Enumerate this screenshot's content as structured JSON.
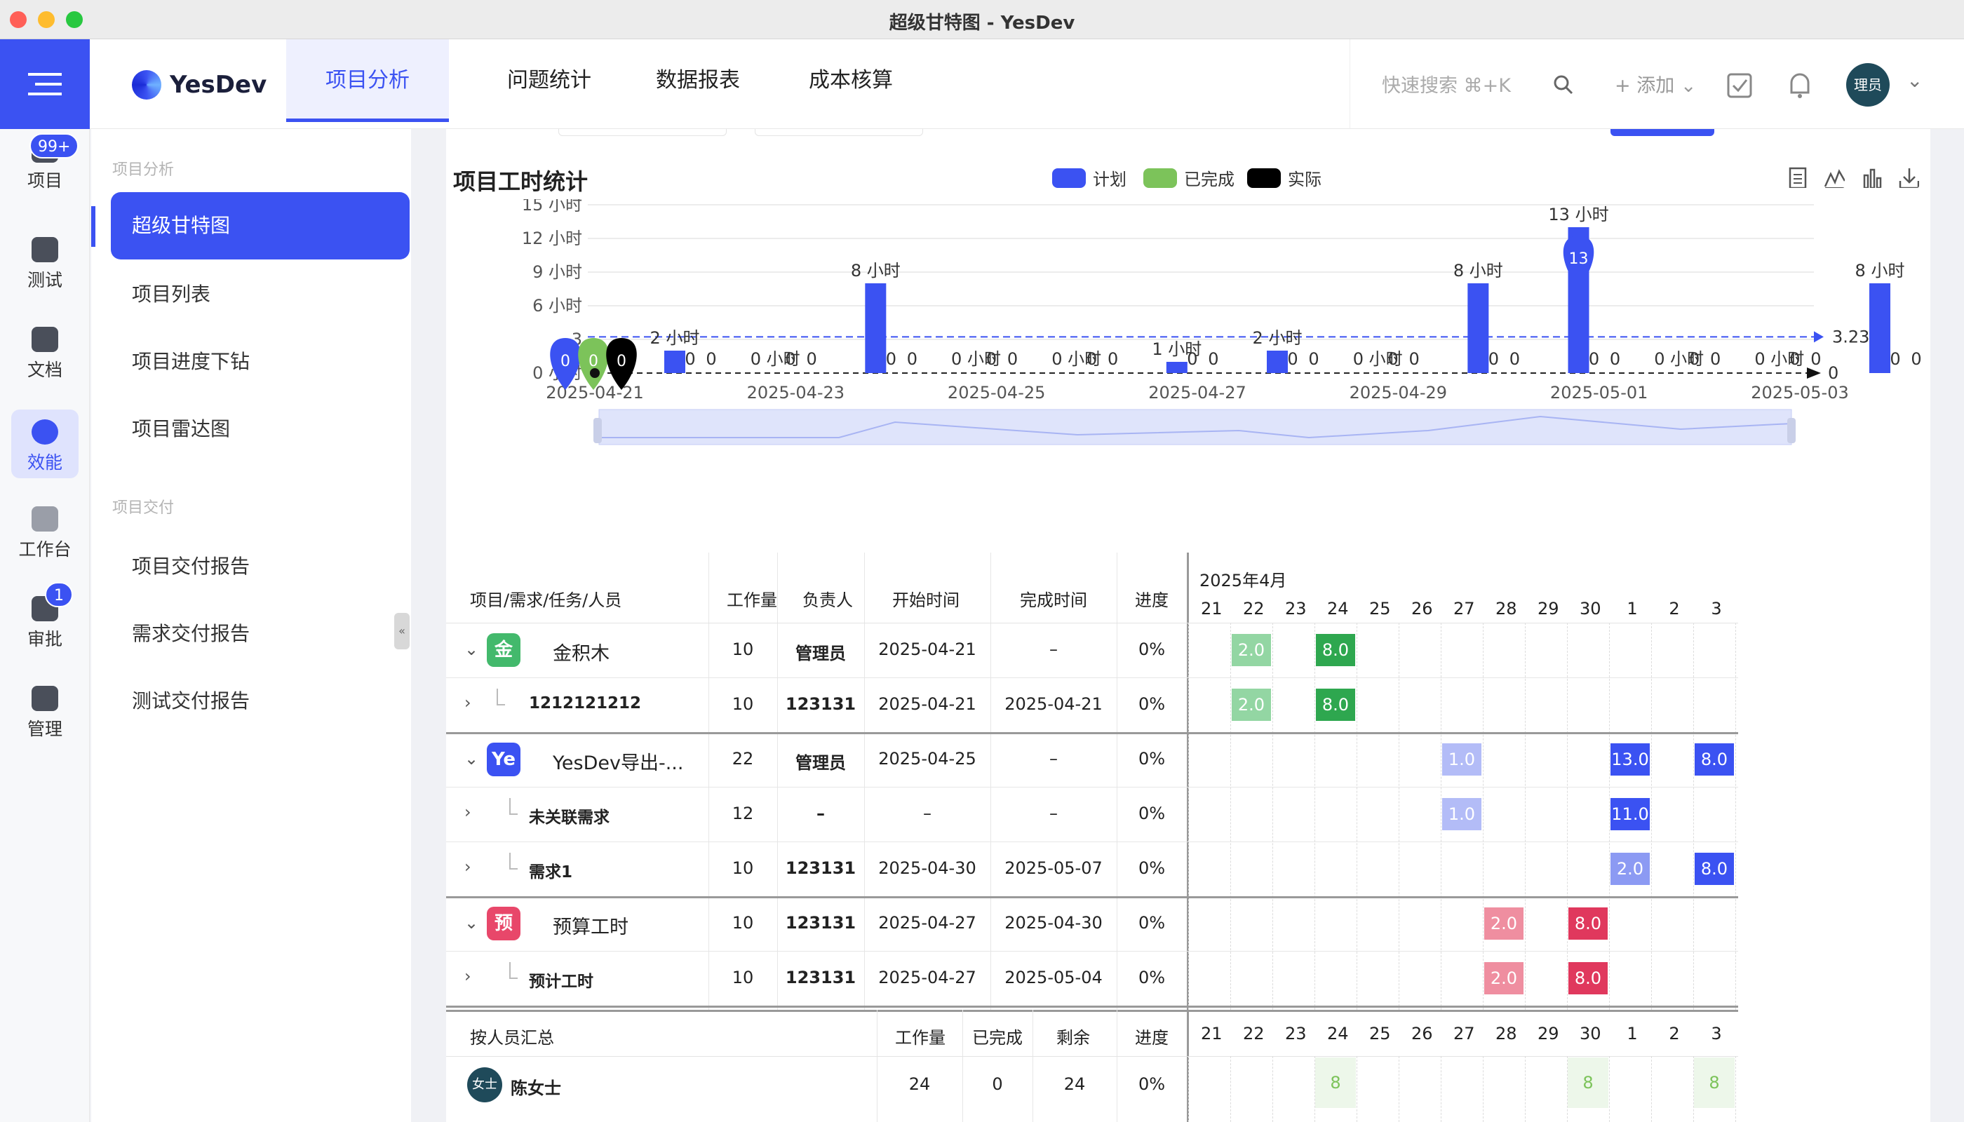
{
  "window": {
    "title": "超级甘特图 - YesDev"
  },
  "rail": {
    "items": [
      {
        "label": "项目",
        "badge": "99+"
      },
      {
        "label": "测试"
      },
      {
        "label": "文档"
      },
      {
        "label": "效能"
      },
      {
        "label": "工作台"
      },
      {
        "label": "审批",
        "badge": "1"
      },
      {
        "label": "管理"
      }
    ]
  },
  "header": {
    "logo": "YesDev",
    "tabs": [
      "项目分析",
      "问题统计",
      "数据报表",
      "成本核算"
    ],
    "search_placeholder": "快速搜索 ⌘+K",
    "add_label": "+ 添加",
    "user": "理员"
  },
  "sidebar": {
    "group1": "项目分析",
    "items1": [
      "超级甘特图",
      "项目列表",
      "项目进度下钻",
      "项目雷达图"
    ],
    "group2": "项目交付",
    "items2": [
      "项目交付报告",
      "需求交付报告",
      "测试交付报告"
    ]
  },
  "chart_section": {
    "title": "项目工时统计"
  },
  "chart_data": {
    "type": "bar",
    "legend": [
      "计划",
      "已完成",
      "实际"
    ],
    "colors": {
      "plan": "#3b52f2",
      "done": "#7cc35a",
      "actual": "#000000"
    },
    "ylabels": [
      "0 小时",
      "3",
      "6 小时",
      "9 小时",
      "12 小时",
      "15 小时"
    ],
    "ylim": [
      0,
      15
    ],
    "dates": [
      "2025-04-21",
      "2025-04-22",
      "2025-04-23",
      "2025-04-24",
      "2025-04-25",
      "2025-04-26",
      "2025-04-27",
      "2025-04-28",
      "2025-04-29",
      "2025-04-30",
      "2025-05-01",
      "2025-05-02",
      "2025-05-03"
    ],
    "xticks": [
      "2025-04-21",
      "2025-04-23",
      "2025-04-25",
      "2025-04-27",
      "2025-04-29",
      "2025-05-01",
      "2025-05-03"
    ],
    "plan": [
      2,
      0,
      8,
      0,
      0,
      1,
      2,
      0,
      8,
      13,
      0,
      0,
      8
    ],
    "done": [
      0,
      0,
      0,
      0,
      0,
      0,
      0,
      0,
      0,
      0,
      0,
      0,
      0
    ],
    "actual": [
      0,
      0,
      0,
      0,
      0,
      0,
      0,
      0,
      0,
      0,
      0,
      0,
      0
    ],
    "bar_labels": [
      "2 小时",
      "0 小时",
      "8 小时",
      "0 小时",
      "0 小时",
      "1 小时",
      "2 小时",
      "0 小时",
      "8 小时",
      "13 小时",
      "0 小时",
      "0 小时",
      "8 小时"
    ],
    "avg_line": 3.23,
    "avg_label": "3.23",
    "end_label": "0",
    "markers": [
      {
        "label": "0"
      },
      {
        "label": "0"
      },
      {
        "label": "0"
      },
      {
        "label": "13"
      }
    ]
  },
  "gantt": {
    "header": {
      "name": "项目/需求/任务/人员",
      "work": "工作量",
      "owner": "负责人",
      "start": "开始时间",
      "end": "完成时间",
      "progress": "进度",
      "month": "2025年4月"
    },
    "days": [
      "21",
      "22",
      "23",
      "24",
      "25",
      "26",
      "27",
      "28",
      "29",
      "30",
      "1",
      "2",
      "3"
    ],
    "rows": [
      {
        "name": "金积木",
        "avatar": "金",
        "color": "#43b96c",
        "work": "10",
        "owner": "管理员",
        "start": "2025-04-21",
        "end": "–",
        "progress": "0%",
        "level": 0,
        "bars": [
          {
            "day": 1,
            "val": "2.0",
            "c": "#93d6a3"
          },
          {
            "day": 3,
            "val": "8.0",
            "c": "#2ea74f"
          }
        ]
      },
      {
        "name": "1212121212",
        "work": "10",
        "owner": "123131",
        "start": "2025-04-21",
        "end": "2025-04-21",
        "progress": "0%",
        "level": 1,
        "bars": [
          {
            "day": 1,
            "val": "2.0",
            "c": "#93d6a3"
          },
          {
            "day": 3,
            "val": "8.0",
            "c": "#2ea74f"
          }
        ]
      },
      {
        "name": "YesDev导出-...",
        "avatar": "Ye",
        "color": "#3b52f2",
        "work": "22",
        "owner": "管理员",
        "start": "2025-04-25",
        "end": "–",
        "progress": "0%",
        "level": 0,
        "bars": [
          {
            "day": 6,
            "val": "1.0",
            "c": "#b3bcf7"
          },
          {
            "day": 10,
            "val": "13.0",
            "c": "#3b52f2"
          },
          {
            "day": 12,
            "val": "8.0",
            "c": "#3b52f2"
          }
        ]
      },
      {
        "name": "未关联需求",
        "work": "12",
        "owner": "–",
        "start": "–",
        "end": "–",
        "progress": "0%",
        "level": 1,
        "bars": [
          {
            "day": 6,
            "val": "1.0",
            "c": "#b3bcf7"
          },
          {
            "day": 10,
            "val": "11.0",
            "c": "#3b52f2"
          }
        ]
      },
      {
        "name": "需求1",
        "work": "10",
        "owner": "123131",
        "start": "2025-04-30",
        "end": "2025-05-07",
        "progress": "0%",
        "level": 1,
        "bars": [
          {
            "day": 10,
            "val": "2.0",
            "c": "#8c9af3"
          },
          {
            "day": 12,
            "val": "8.0",
            "c": "#3b52f2"
          }
        ]
      },
      {
        "name": "预算工时",
        "avatar": "预",
        "color": "#e8476a",
        "work": "10",
        "owner": "123131",
        "start": "2025-04-27",
        "end": "2025-04-30",
        "progress": "0%",
        "level": 0,
        "bars": [
          {
            "day": 7,
            "val": "2.0",
            "c": "#ef8ea0"
          },
          {
            "day": 9,
            "val": "8.0",
            "c": "#e0385d"
          }
        ]
      },
      {
        "name": "预计工时",
        "work": "10",
        "owner": "123131",
        "start": "2025-04-27",
        "end": "2025-05-04",
        "progress": "0%",
        "level": 1,
        "bars": [
          {
            "day": 7,
            "val": "2.0",
            "c": "#ef8ea0"
          },
          {
            "day": 9,
            "val": "8.0",
            "c": "#e0385d"
          }
        ]
      }
    ],
    "summary": {
      "title": "按人员汇总",
      "work": "工作量",
      "done": "已完成",
      "remain": "剩余",
      "progress": "进度"
    },
    "people": [
      {
        "name": "陈女士",
        "avatar": "女士",
        "work": "24",
        "done": "0",
        "remain": "24",
        "progress": "0%",
        "cells": [
          {
            "day": 3,
            "val": "8"
          },
          {
            "day": 9,
            "val": "8"
          },
          {
            "day": 12,
            "val": "8"
          }
        ]
      }
    ]
  }
}
